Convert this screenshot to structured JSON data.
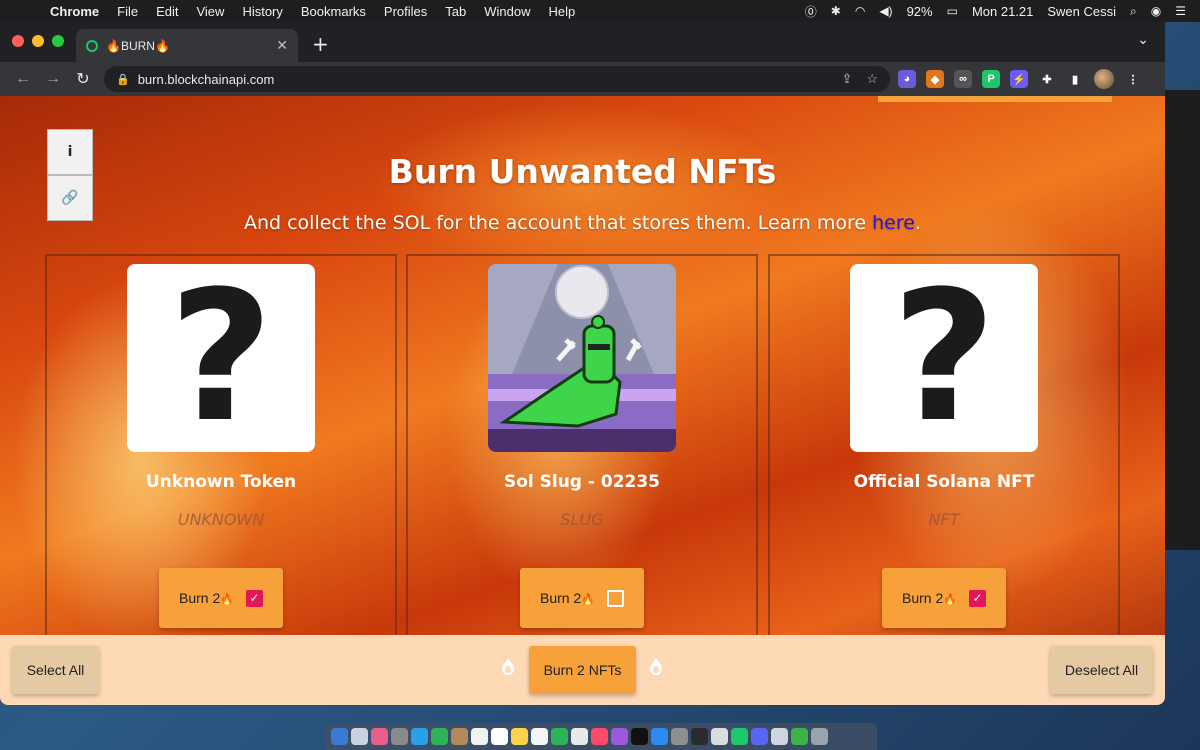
{
  "menubar": {
    "app": "Chrome",
    "items": [
      "File",
      "Edit",
      "View",
      "History",
      "Bookmarks",
      "Profiles",
      "Tab",
      "Window",
      "Help"
    ],
    "battery": "92%",
    "clock": "Mon 21.21",
    "user": "Swen Cessi"
  },
  "browser": {
    "tab_title": "🔥BURN🔥",
    "url": "burn.blockchainapi.com"
  },
  "page": {
    "info_label": "i",
    "headline": "Burn Unwanted NFTs",
    "subline_text": "And collect the SOL for the account that stores them. Learn more ",
    "subline_link": "here",
    "subline_end": ".",
    "cards": [
      {
        "name": "Unknown Token",
        "symbol": "UNKNOWN",
        "burn_label": "Burn 2",
        "checked": true,
        "image": "question-mark"
      },
      {
        "name": "Sol Slug - 02235",
        "symbol": "SLUG",
        "burn_label": "Burn 2",
        "checked": false,
        "image": "sol-slug"
      },
      {
        "name": "Official Solana NFT",
        "symbol": "NFT",
        "burn_label": "Burn 2",
        "checked": true,
        "image": "question-mark"
      }
    ],
    "question_glyph": "?"
  },
  "footer": {
    "select_all": "Select All",
    "burn_selected": "Burn 2 NFTs",
    "deselect_all": "Deselect All"
  },
  "colors": {
    "accent_orange": "#f7a13a",
    "checkbox_pink": "#e4165a",
    "footer_bg": "#fed9b6",
    "link_blue": "#2a13d6"
  }
}
